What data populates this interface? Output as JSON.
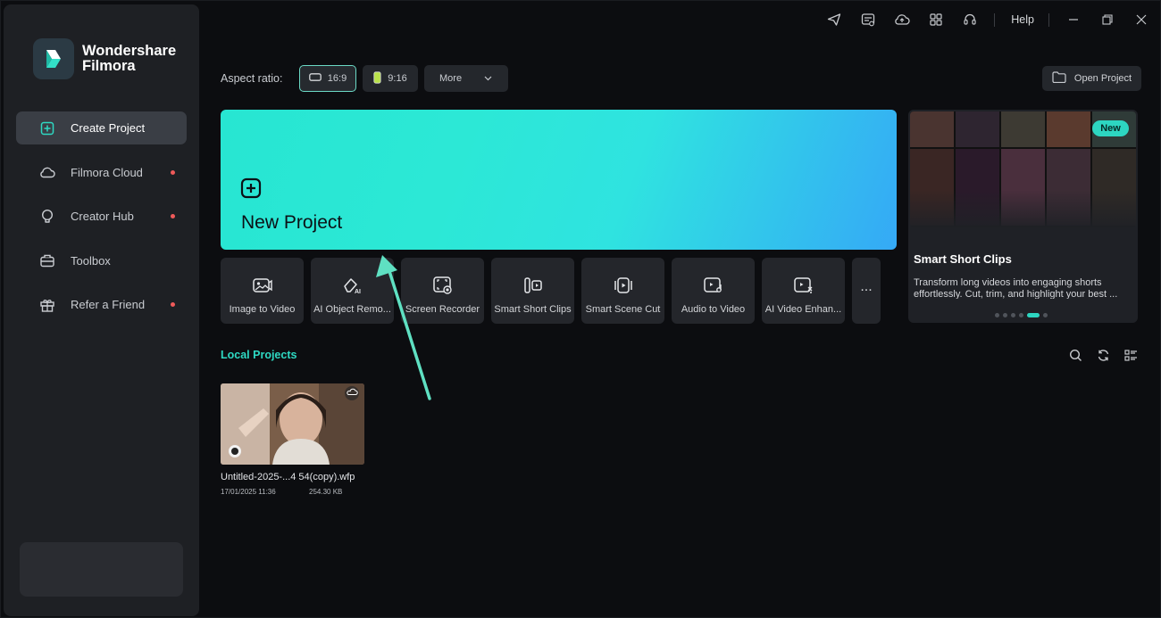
{
  "app": {
    "name_line1": "Wondershare",
    "name_line2": "Filmora"
  },
  "sidebar": {
    "items": [
      {
        "label": "Create Project",
        "icon": "plus-square-icon",
        "active": true,
        "dot": false
      },
      {
        "label": "Filmora Cloud",
        "icon": "cloud-icon",
        "active": false,
        "dot": true
      },
      {
        "label": "Creator Hub",
        "icon": "lightbulb-icon",
        "active": false,
        "dot": true
      },
      {
        "label": "Toolbox",
        "icon": "toolbox-icon",
        "active": false,
        "dot": false
      },
      {
        "label": "Refer a Friend",
        "icon": "gift-icon",
        "active": false,
        "dot": true
      }
    ]
  },
  "topbar": {
    "icons": [
      "send-icon",
      "subtitle-icon",
      "cloud-upload-icon",
      "grid-icon",
      "headset-icon"
    ],
    "help": "Help"
  },
  "aspect": {
    "label": "Aspect ratio:",
    "options": [
      "16:9",
      "9:16"
    ],
    "selected": "16:9",
    "more": "More",
    "open_project": "Open Project"
  },
  "new_project": {
    "title": "New Project"
  },
  "tools": [
    {
      "label": "Image to Video",
      "icon": "image-to-video-icon"
    },
    {
      "label": "AI Object Remo...",
      "icon": "eraser-ai-icon"
    },
    {
      "label": "Screen Recorder",
      "icon": "screen-recorder-icon"
    },
    {
      "label": "Smart Short Clips",
      "icon": "short-clips-icon"
    },
    {
      "label": "Smart Scene Cut",
      "icon": "scene-cut-icon"
    },
    {
      "label": "Audio to Video",
      "icon": "audio-to-video-icon"
    },
    {
      "label": "AI Video Enhan...",
      "icon": "video-enhancer-icon"
    }
  ],
  "tools_more": "...",
  "promo": {
    "badge": "New",
    "title": "Smart Short Clips",
    "description": "Transform long videos into engaging shorts effortlessly. Cut, trim, and highlight your best ...",
    "page_count": 6,
    "page_active": 5
  },
  "local_projects": {
    "title": "Local Projects",
    "items": [
      {
        "name": "Untitled-2025-...4 54(copy).wfp",
        "date": "17/01/2025 11:36",
        "size": "254.30 KB"
      }
    ]
  },
  "colors": {
    "accent": "#2ed9c3",
    "banner_start": "#27e6d2",
    "banner_end": "#35a9f6",
    "notification_dot": "#ef5a5a",
    "arrow": "#5fe0c2"
  }
}
